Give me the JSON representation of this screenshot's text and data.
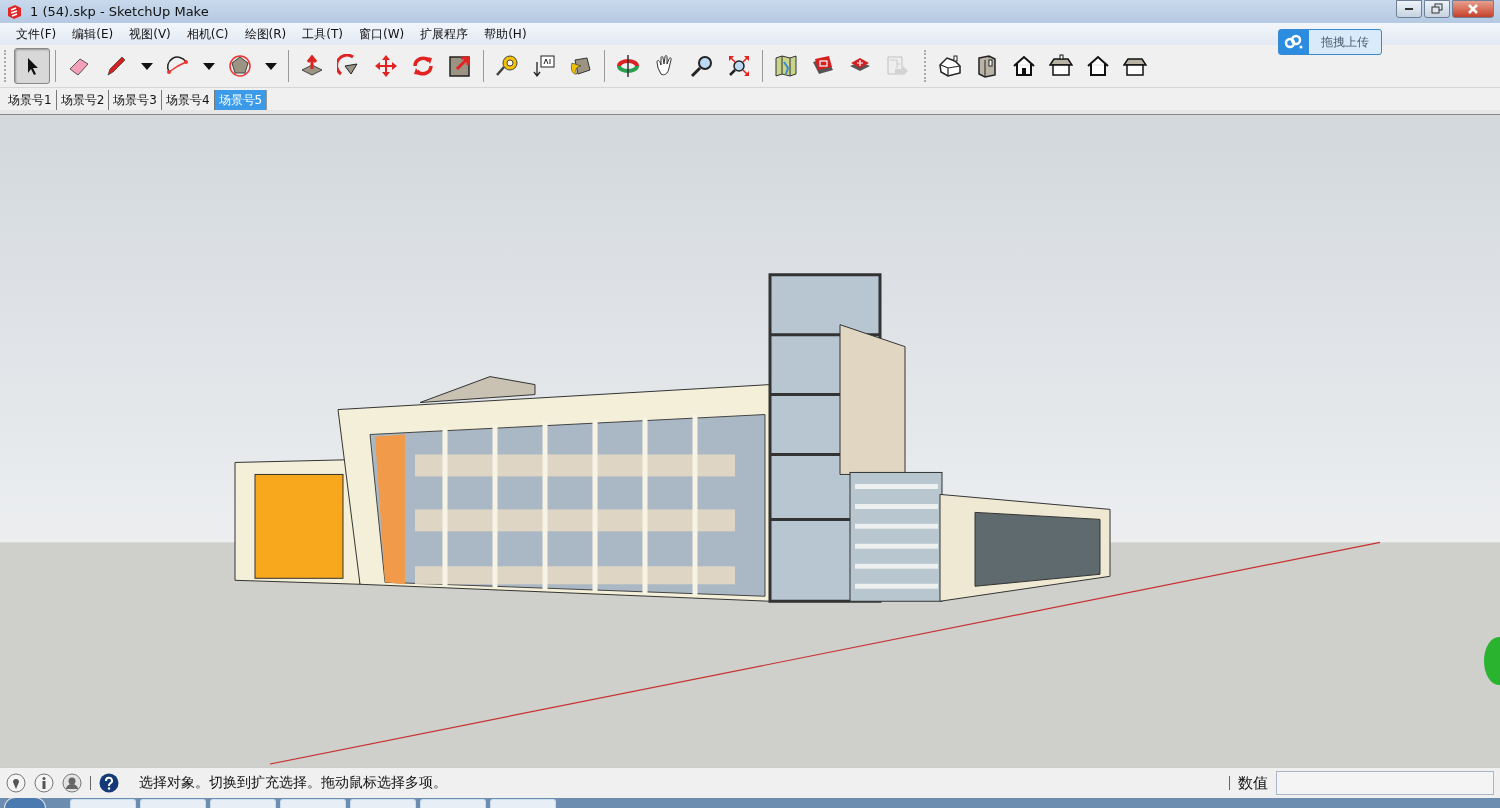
{
  "window": {
    "title": "1 (54).skp - SketchUp Make"
  },
  "menu": [
    "文件(F)",
    "编辑(E)",
    "视图(V)",
    "相机(C)",
    "绘图(R)",
    "工具(T)",
    "窗口(W)",
    "扩展程序",
    "帮助(H)"
  ],
  "upload_button": {
    "label": "拖拽上传"
  },
  "toolbars": [
    {
      "tools": [
        {
          "kind": "select",
          "selected": true,
          "disabled": false
        }
      ]
    },
    {
      "tools": [
        {
          "kind": "eraser",
          "selected": false,
          "disabled": false
        },
        {
          "kind": "pencil",
          "selected": false,
          "disabled": false
        },
        {
          "kind": "dropdown",
          "selected": false,
          "disabled": false
        },
        {
          "kind": "arc",
          "selected": false,
          "disabled": false
        },
        {
          "kind": "dropdown",
          "selected": false,
          "disabled": false
        },
        {
          "kind": "polygon",
          "selected": false,
          "disabled": false
        },
        {
          "kind": "dropdown",
          "selected": false,
          "disabled": false
        }
      ]
    },
    {
      "tools": [
        {
          "kind": "pushpull",
          "selected": false,
          "disabled": false
        },
        {
          "kind": "followme",
          "selected": false,
          "disabled": false
        },
        {
          "kind": "move",
          "selected": false,
          "disabled": false
        },
        {
          "kind": "rotate",
          "selected": false,
          "disabled": false
        },
        {
          "kind": "scale",
          "selected": false,
          "disabled": false
        }
      ]
    },
    {
      "tools": [
        {
          "kind": "tape",
          "selected": false,
          "disabled": false
        },
        {
          "kind": "text",
          "selected": false,
          "disabled": false
        },
        {
          "kind": "paint",
          "selected": false,
          "disabled": false
        }
      ]
    },
    {
      "tools": [
        {
          "kind": "orbit",
          "selected": false,
          "disabled": false
        },
        {
          "kind": "pan",
          "selected": false,
          "disabled": false
        },
        {
          "kind": "zoom",
          "selected": false,
          "disabled": false
        },
        {
          "kind": "zoomext",
          "selected": false,
          "disabled": false
        }
      ]
    },
    {
      "tools": [
        {
          "kind": "map",
          "selected": false,
          "disabled": false
        },
        {
          "kind": "warehouse",
          "selected": false,
          "disabled": false
        },
        {
          "kind": "extension",
          "selected": false,
          "disabled": false
        },
        {
          "kind": "share",
          "selected": false,
          "disabled": true
        }
      ]
    },
    {
      "tools": [
        {
          "kind": "iso",
          "selected": false,
          "disabled": false
        },
        {
          "kind": "box",
          "selected": false,
          "disabled": false
        },
        {
          "kind": "front",
          "selected": false,
          "disabled": false
        },
        {
          "kind": "top",
          "selected": false,
          "disabled": false
        },
        {
          "kind": "outline",
          "selected": false,
          "disabled": false
        },
        {
          "kind": "roof",
          "selected": false,
          "disabled": false
        }
      ]
    }
  ],
  "scene_tabs": [
    {
      "label": "场景号1",
      "selected": false
    },
    {
      "label": "场景号2",
      "selected": false
    },
    {
      "label": "场景号3",
      "selected": false
    },
    {
      "label": "场景号4",
      "selected": false
    },
    {
      "label": "场景号5",
      "selected": true
    }
  ],
  "status_bar": {
    "hint": "选择对象。切换到扩充选择。拖动鼠标选择多项。",
    "measurement_label": "数值"
  }
}
